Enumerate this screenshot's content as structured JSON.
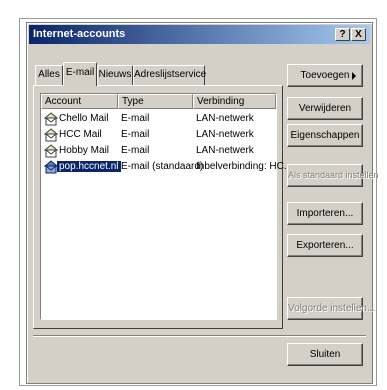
{
  "window": {
    "title": "Internet-accounts"
  },
  "titlebar_buttons": {
    "help": "?",
    "close": "X"
  },
  "tabs": [
    {
      "label": "Alles"
    },
    {
      "label": "E-mail"
    },
    {
      "label": "Nieuws"
    },
    {
      "label": "Adreslijstservice"
    }
  ],
  "list": {
    "columns": [
      "Account",
      "Type",
      "Verbinding"
    ],
    "rows": [
      {
        "account": "Chello Mail",
        "type": "E-mail",
        "connection": "LAN-netwerk",
        "selected": false
      },
      {
        "account": "HCC Mail",
        "type": "E-mail",
        "connection": "LAN-netwerk",
        "selected": false
      },
      {
        "account": "Hobby Mail",
        "type": "E-mail",
        "connection": "LAN-netwerk",
        "selected": false
      },
      {
        "account": "pop.hccnet.nl",
        "type": "E-mail (standaard)",
        "connection": "Inbelverbinding: HC...",
        "selected": true
      }
    ]
  },
  "buttons": {
    "add": "Toevoegen",
    "remove": "Verwijderen",
    "properties": "Eigenschappen",
    "set_default": "Als standaard instellen",
    "import": "Importeren...",
    "export": "Exporteren...",
    "order": "Volgorde instellen...",
    "close": "Sluiten"
  },
  "colors": {
    "title_start": "#0a246a",
    "title_end": "#a6caf0",
    "selection": "#0a246a"
  }
}
